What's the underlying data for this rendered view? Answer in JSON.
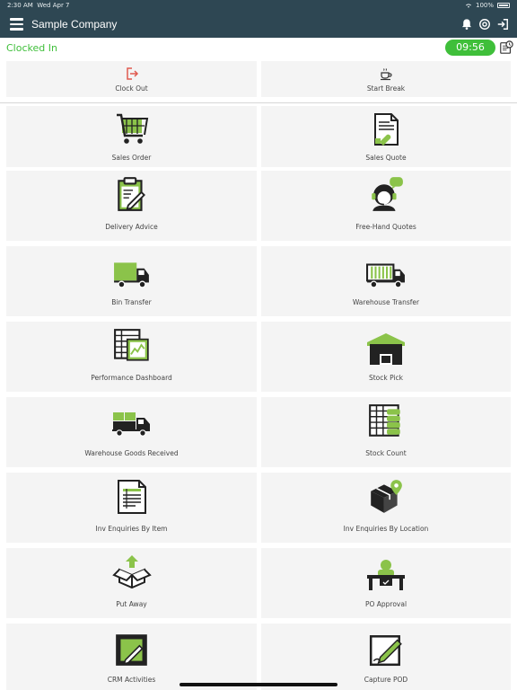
{
  "status_bar": {
    "time": "2:30 AM",
    "date": "Wed Apr 7",
    "battery": "100%"
  },
  "header": {
    "company": "Sample Company",
    "clock_status": "Clocked In",
    "timer": "09:56"
  },
  "quick_actions": [
    {
      "label": "Clock Out",
      "icon": "clock-out-icon"
    },
    {
      "label": "Start Break",
      "icon": "coffee-cup-icon"
    }
  ],
  "tiles": [
    {
      "label": "Sales Order",
      "icon": "shopping-cart-icon"
    },
    {
      "label": "Sales Quote",
      "icon": "quote-document-icon"
    },
    {
      "label": "Delivery Advice",
      "icon": "clipboard-icon"
    },
    {
      "label": "Free-Hand Quotes",
      "icon": "headset-agent-icon"
    },
    {
      "label": "Bin Transfer",
      "icon": "truck-icon"
    },
    {
      "label": "Warehouse Transfer",
      "icon": "container-truck-icon"
    },
    {
      "label": "Performance Dashboard",
      "icon": "dashboard-chart-icon"
    },
    {
      "label": "Stock Pick",
      "icon": "warehouse-icon"
    },
    {
      "label": "Warehouse Goods Received",
      "icon": "delivery-truck-boxes-icon"
    },
    {
      "label": "Stock Count",
      "icon": "stock-count-icon"
    },
    {
      "label": "Inv Enquiries By Item",
      "icon": "document-list-icon"
    },
    {
      "label": "Inv Enquiries By Location",
      "icon": "box-location-icon"
    },
    {
      "label": "Put Away",
      "icon": "open-box-arrow-icon"
    },
    {
      "label": "PO Approval",
      "icon": "desk-approval-icon"
    },
    {
      "label": "CRM Activities",
      "icon": "crm-edit-icon"
    },
    {
      "label": "Capture POD",
      "icon": "signature-pen-icon"
    }
  ],
  "colors": {
    "header": "#2e4753",
    "accent_green": "#3fbf3a",
    "icon_green": "#8bc34a",
    "tile_bg": "#f4f4f4",
    "clock_out_red": "#e05a4f"
  }
}
